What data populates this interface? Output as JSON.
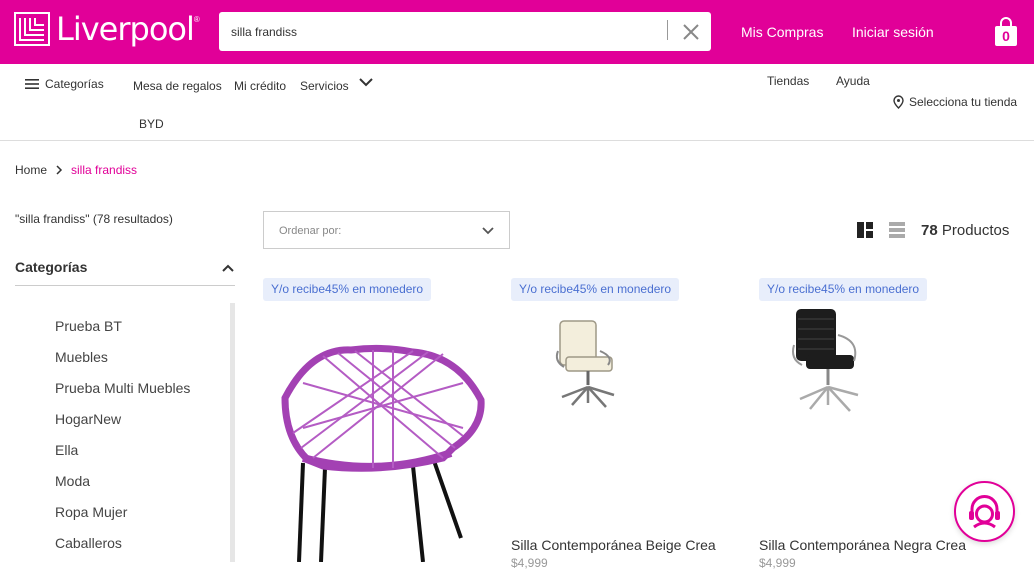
{
  "header": {
    "logo_text": "Liverpool",
    "logo_reg": "®",
    "search_value": "silla frandiss",
    "my_purchases": "Mis Compras",
    "sign_in": "Iniciar sesión",
    "bag_count": "0"
  },
  "nav": {
    "categories": "Categorías",
    "gift_table": "Mesa de regalos",
    "credit": "Mi crédito",
    "services": "Servicios",
    "byd": "BYD",
    "stores": "Tiendas",
    "help": "Ayuda",
    "select_store": "Selecciona tu tienda"
  },
  "breadcrumb": {
    "home": "Home",
    "current": "silla frandiss"
  },
  "results_text": "\"silla frandiss\" (78 resultados)",
  "filters": {
    "title": "Categorías",
    "items": [
      "Prueba BT",
      "Muebles",
      "Prueba Multi Muebles",
      "HogarNew",
      "Ella",
      "Moda",
      "Ropa Mujer",
      "Caballeros"
    ]
  },
  "sort": {
    "placeholder": "Ordenar por:"
  },
  "product_count": {
    "number": "78",
    "label": "Productos"
  },
  "products": [
    {
      "badge": "Y/o recibe45% en monedero",
      "name": "",
      "price": ""
    },
    {
      "badge": "Y/o recibe45% en monedero",
      "name": "Silla Contemporánea Beige Crea",
      "price": "$4,999"
    },
    {
      "badge": "Y/o recibe45% en monedero",
      "name": "Silla Contemporánea Negra Crea",
      "price": "$4,999"
    }
  ],
  "colors": {
    "brand": "#e10098",
    "badge_bg": "#e8eefb",
    "badge_text": "#4a6fd1"
  }
}
